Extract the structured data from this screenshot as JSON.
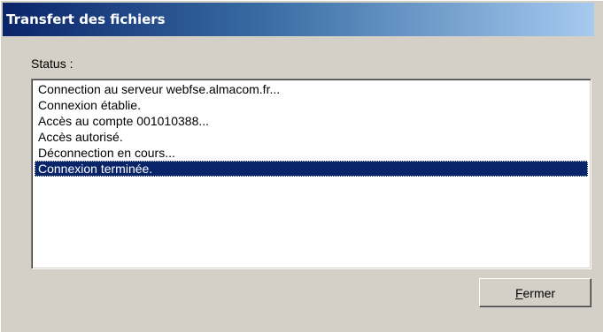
{
  "window": {
    "title": "Transfert des fichiers"
  },
  "status": {
    "label": "Status :"
  },
  "log": {
    "items": [
      {
        "text": "Connection au serveur webfse.almacom.fr...",
        "selected": false
      },
      {
        "text": "Connexion établie.",
        "selected": false
      },
      {
        "text": "Accès au compte 001010388...",
        "selected": false
      },
      {
        "text": "Accès autorisé.",
        "selected": false
      },
      {
        "text": "Déconnection en cours...",
        "selected": false
      },
      {
        "text": "Connexion terminée.",
        "selected": true
      }
    ]
  },
  "buttons": {
    "close": {
      "mnemonic": "F",
      "rest": "ermer"
    }
  },
  "colors": {
    "titlebar_start": "#0a246a",
    "titlebar_end": "#a6caf0",
    "selection": "#0a246a",
    "face": "#d4d0c8"
  }
}
